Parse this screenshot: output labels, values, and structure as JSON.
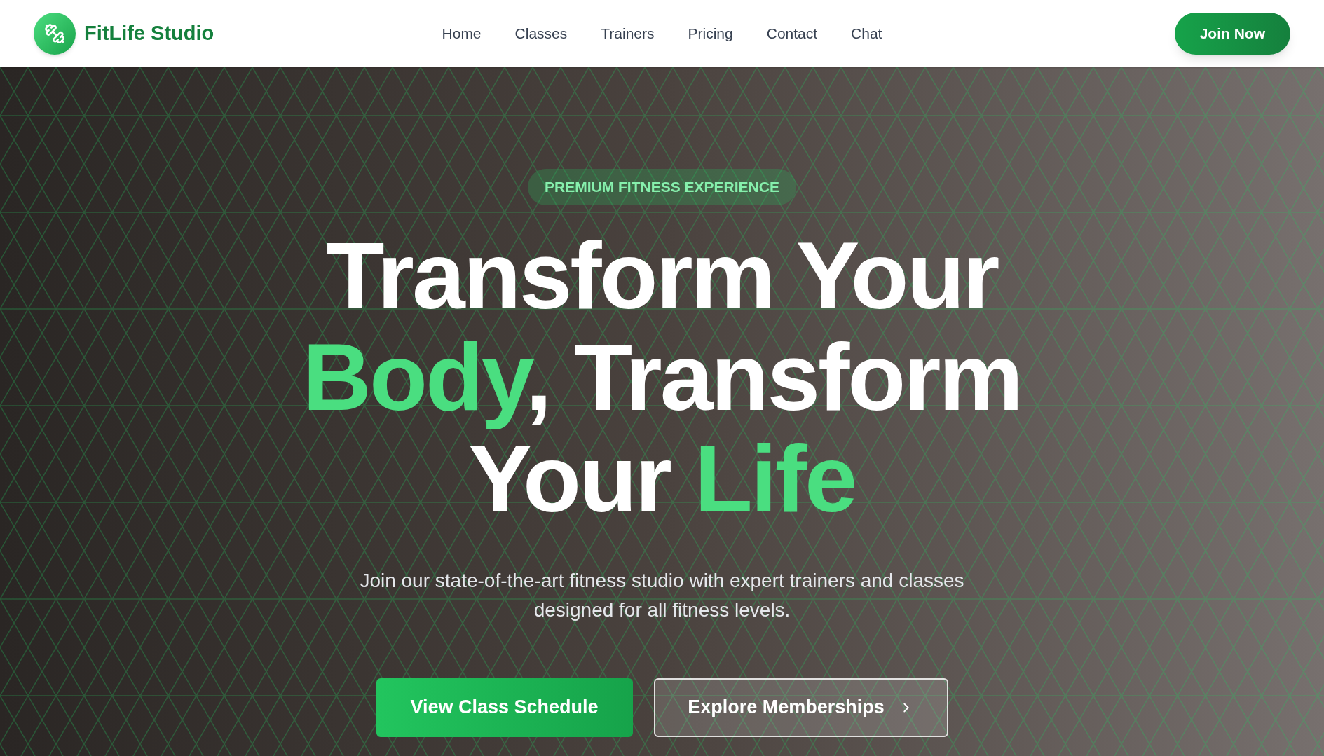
{
  "header": {
    "brand": "FitLife Studio",
    "nav": [
      {
        "label": "Home"
      },
      {
        "label": "Classes"
      },
      {
        "label": "Trainers"
      },
      {
        "label": "Pricing"
      },
      {
        "label": "Contact"
      },
      {
        "label": "Chat"
      }
    ],
    "cta": "Join Now"
  },
  "hero": {
    "badge": "PREMIUM FITNESS EXPERIENCE",
    "headline": [
      [
        {
          "text": "Transform Your",
          "highlight": false
        }
      ],
      [
        {
          "text": "Body",
          "highlight": true
        },
        {
          "text": ", Transform",
          "highlight": false
        }
      ],
      [
        {
          "text": "Your ",
          "highlight": false
        },
        {
          "text": "Life",
          "highlight": true
        }
      ]
    ],
    "subtitle": "Join our state-of-the-art fitness studio with expert trainers and classes designed for all fitness levels.",
    "buttons": [
      {
        "label": "View Class Schedule",
        "kind": "primary"
      },
      {
        "label": "Explore Memberships",
        "kind": "outline"
      }
    ]
  }
}
